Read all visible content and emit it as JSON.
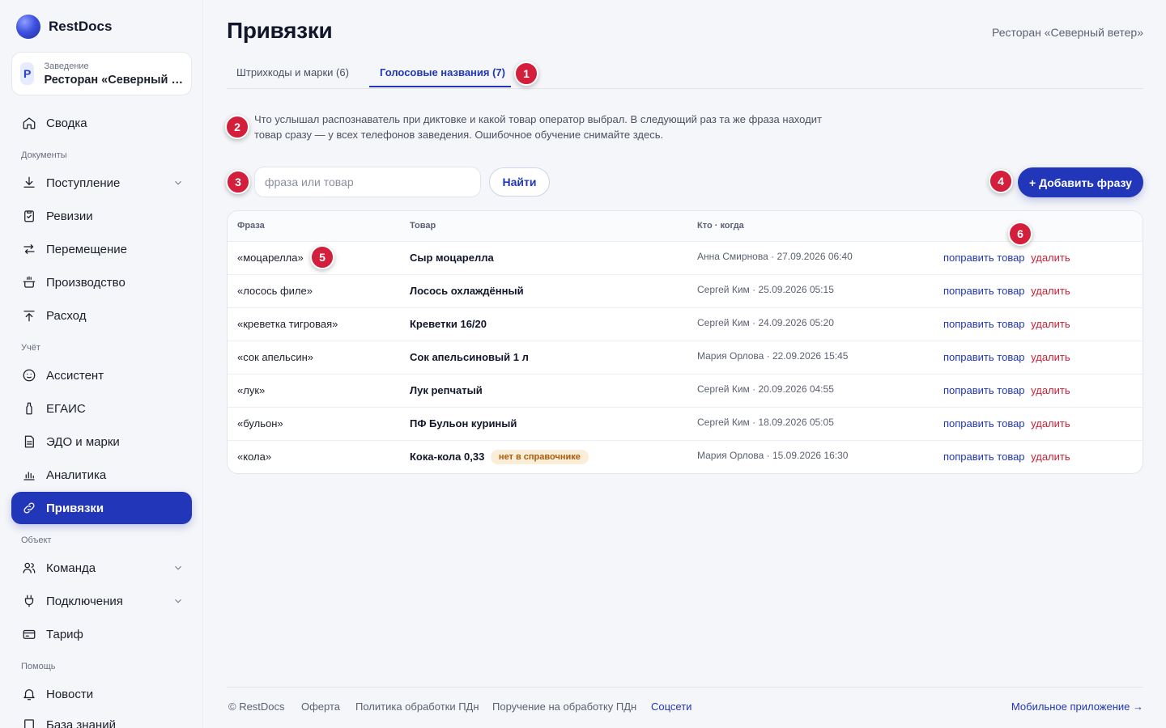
{
  "brand": {
    "name": "RestDocs"
  },
  "venue": {
    "badge": "Р",
    "label": "Заведение",
    "name": "Ресторан «Северный …"
  },
  "nav": {
    "sections": {
      "documents": "Документы",
      "accounting": "Учёт",
      "object": "Объект",
      "help": "Помощь"
    },
    "items": [
      {
        "label": "Сводка",
        "icon": "home-icon"
      },
      {
        "label": "Поступление",
        "icon": "download-icon"
      },
      {
        "label": "Ревизии",
        "icon": "clipboard-icon"
      },
      {
        "label": "Перемещение",
        "icon": "transfer-icon"
      },
      {
        "label": "Производство",
        "icon": "pot-icon"
      },
      {
        "label": "Расход",
        "icon": "upload-icon"
      },
      {
        "label": "Ассистент",
        "icon": "assistant-icon"
      },
      {
        "label": "ЕГАИС",
        "icon": "bottle-icon"
      },
      {
        "label": "ЭДО и марки",
        "icon": "document-icon"
      },
      {
        "label": "Аналитика",
        "icon": "chart-icon"
      },
      {
        "label": "Привязки",
        "icon": "link-icon"
      },
      {
        "label": "Команда",
        "icon": "team-icon"
      },
      {
        "label": "Подключения",
        "icon": "plug-icon"
      },
      {
        "label": "Тариф",
        "icon": "card-icon"
      },
      {
        "label": "Новости",
        "icon": "bell-icon"
      },
      {
        "label": "База знаний",
        "icon": "book-icon"
      }
    ]
  },
  "header": {
    "title": "Привязки",
    "venue": "Ресторан «Северный ветер»"
  },
  "tabs": [
    {
      "label": "Штрихкоды и марки (6)"
    },
    {
      "label": "Голосовые названия (7)"
    }
  ],
  "description": "Что услышал распознаватель при диктовке и какой товар оператор выбрал. В следующий раз та же фраза находит товар сразу — у всех телефонов заведения. Ошибочное обучение снимайте здесь.",
  "search": {
    "placeholder": "фраза или товар",
    "button": "Найти"
  },
  "add_button": "+ Добавить фразу",
  "markers": [
    "1",
    "2",
    "3",
    "4",
    "5",
    "6"
  ],
  "table": {
    "headers": {
      "phrase": "Фраза",
      "product": "Товар",
      "who": "Кто · когда"
    },
    "rows": [
      {
        "phrase": "«моцарелла»",
        "product": "Сыр моцарелла",
        "who": "Анна Смирнова · 27.09.2026 06:40",
        "fix": "поправить товар",
        "del": "удалить"
      },
      {
        "phrase": "«лосось филе»",
        "product": "Лосось охлаждённый",
        "who": "Сергей Ким · 25.09.2026 05:15",
        "fix": "поправить товар",
        "del": "удалить"
      },
      {
        "phrase": "«креветка тигровая»",
        "product": "Креветки 16/20",
        "who": "Сергей Ким · 24.09.2026 05:20",
        "fix": "поправить товар",
        "del": "удалить"
      },
      {
        "phrase": "«сок апельсин»",
        "product": "Сок апельсиновый 1 л",
        "who": "Мария Орлова · 22.09.2026 15:45",
        "fix": "поправить товар",
        "del": "удалить"
      },
      {
        "phrase": "«лук»",
        "product": "Лук репчатый",
        "who": "Сергей Ким · 20.09.2026 04:55",
        "fix": "поправить товар",
        "del": "удалить"
      },
      {
        "phrase": "«бульон»",
        "product": "ПФ Бульон куриный",
        "who": "Сергей Ким · 18.09.2026 05:05",
        "fix": "поправить товар",
        "del": "удалить"
      },
      {
        "phrase": "«кола»",
        "product": "Кока-кола 0,33",
        "badge": "нет в справочнике",
        "who": "Мария Орлова · 15.09.2026 16:30",
        "fix": "поправить товар",
        "del": "удалить"
      }
    ]
  },
  "footer": {
    "copyright": "© RestDocs",
    "offer": "Оферта",
    "policy": "Политика обработки ПДн",
    "assignment": "Поручение на обработку ПДн",
    "social": "Соцсети",
    "mobile": "Мобильное приложение →"
  }
}
